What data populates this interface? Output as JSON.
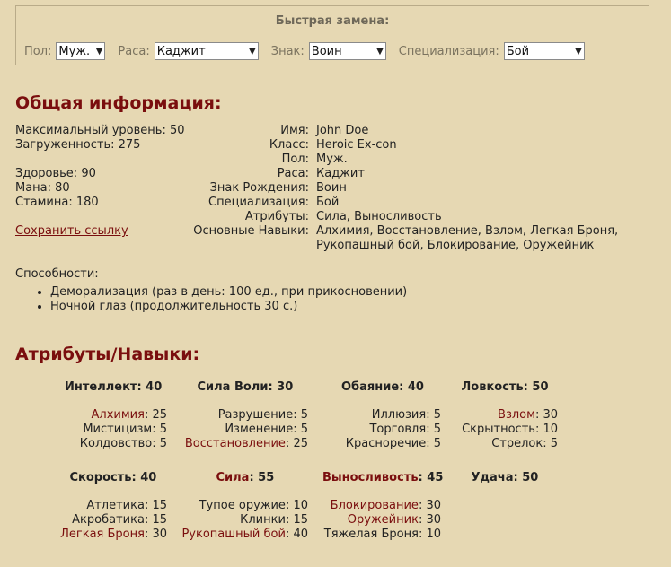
{
  "quick": {
    "title": "Быстрая замена:",
    "fields": [
      {
        "label": "Пол:",
        "value": "Муж."
      },
      {
        "label": "Раса:",
        "value": "Каджит"
      },
      {
        "label": "Знак:",
        "value": "Воин"
      },
      {
        "label": "Специализация:",
        "value": "Бой"
      }
    ]
  },
  "general": {
    "heading": "Общая информация:",
    "max_level": "Максимальный уровень: 50",
    "encumbrance": "Загруженность: 275",
    "health": "Здоровье: 90",
    "mana": "Мана: 80",
    "stamina": "Стамина: 180",
    "save_link": "Сохранить ссылку",
    "labels": {
      "name": "Имя:",
      "class": "Класс:",
      "sex": "Пол:",
      "race": "Раса:",
      "sign": "Знак Рождения:",
      "spec": "Специализация:",
      "attrs": "Атрибуты:",
      "skills": "Основные Навыки:"
    },
    "values": {
      "name": "John Doe",
      "class": "Heroic Ex-con",
      "sex": "Муж.",
      "race": "Каджит",
      "sign": "Воин",
      "spec": "Бой",
      "attrs": "Сила, Выносливость",
      "skills_line1": "Алхимия, Восстановление, Взлом, Легкая Броня,",
      "skills_line2": "Рукопашный бой, Блокирование, Оружейник"
    },
    "abilities_label": "Способности:",
    "abilities": [
      "Деморализация (раз в день: 100 ед., при прикосновении)",
      "Ночной глаз (продолжительность 30 с.)"
    ]
  },
  "attributes_heading": "Атрибуты/Навыки:",
  "attributes": [
    {
      "name": "Интеллект",
      "value": ": 40",
      "major": false,
      "skills": [
        {
          "name": "Алхимия",
          "value": ": 25",
          "major": true
        },
        {
          "name": "Мистицизм",
          "value": ": 5",
          "major": false
        },
        {
          "name": "Колдовство",
          "value": ": 5",
          "major": false
        }
      ]
    },
    {
      "name": "Сила Воли",
      "value": ": 30",
      "major": false,
      "skills": [
        {
          "name": "Разрушение",
          "value": ": 5",
          "major": false
        },
        {
          "name": "Изменение",
          "value": ": 5",
          "major": false
        },
        {
          "name": "Восстановление",
          "value": ": 25",
          "major": true
        }
      ]
    },
    {
      "name": "Обаяние",
      "value": ": 40",
      "major": false,
      "skills": [
        {
          "name": "Иллюзия",
          "value": ": 5",
          "major": false
        },
        {
          "name": "Торговля",
          "value": ": 5",
          "major": false
        },
        {
          "name": "Красноречие",
          "value": ": 5",
          "major": false
        }
      ]
    },
    {
      "name": "Ловкость",
      "value": ": 50",
      "major": false,
      "skills": [
        {
          "name": "Взлом",
          "value": ": 30",
          "major": true
        },
        {
          "name": "Скрытность",
          "value": ": 10",
          "major": false
        },
        {
          "name": "Стрелок",
          "value": ": 5",
          "major": false
        }
      ]
    },
    {
      "name": "Скорость",
      "value": ": 40",
      "major": false,
      "skills": [
        {
          "name": "Атлетика",
          "value": ": 15",
          "major": false
        },
        {
          "name": "Акробатика",
          "value": ": 15",
          "major": false
        },
        {
          "name": "Легкая Броня",
          "value": ": 30",
          "major": true
        }
      ]
    },
    {
      "name": "Сила",
      "value": ": 55",
      "major": true,
      "skills": [
        {
          "name": "Тупое оружие",
          "value": ": 10",
          "major": false
        },
        {
          "name": "Клинки",
          "value": ": 15",
          "major": false
        },
        {
          "name": "Рукопашный бой",
          "value": ": 40",
          "major": true
        }
      ]
    },
    {
      "name": "Выносливость",
      "value": ": 45",
      "major": true,
      "skills": [
        {
          "name": "Блокирование",
          "value": ": 30",
          "major": true
        },
        {
          "name": "Оружейник",
          "value": ": 30",
          "major": true
        },
        {
          "name": "Тяжелая Броня",
          "value": ": 10",
          "major": false
        }
      ]
    },
    {
      "name": "Удача",
      "value": ": 50",
      "major": false,
      "skills": []
    }
  ],
  "colors": {
    "background": "#e6d8b3",
    "accent": "#7a0e0e"
  }
}
